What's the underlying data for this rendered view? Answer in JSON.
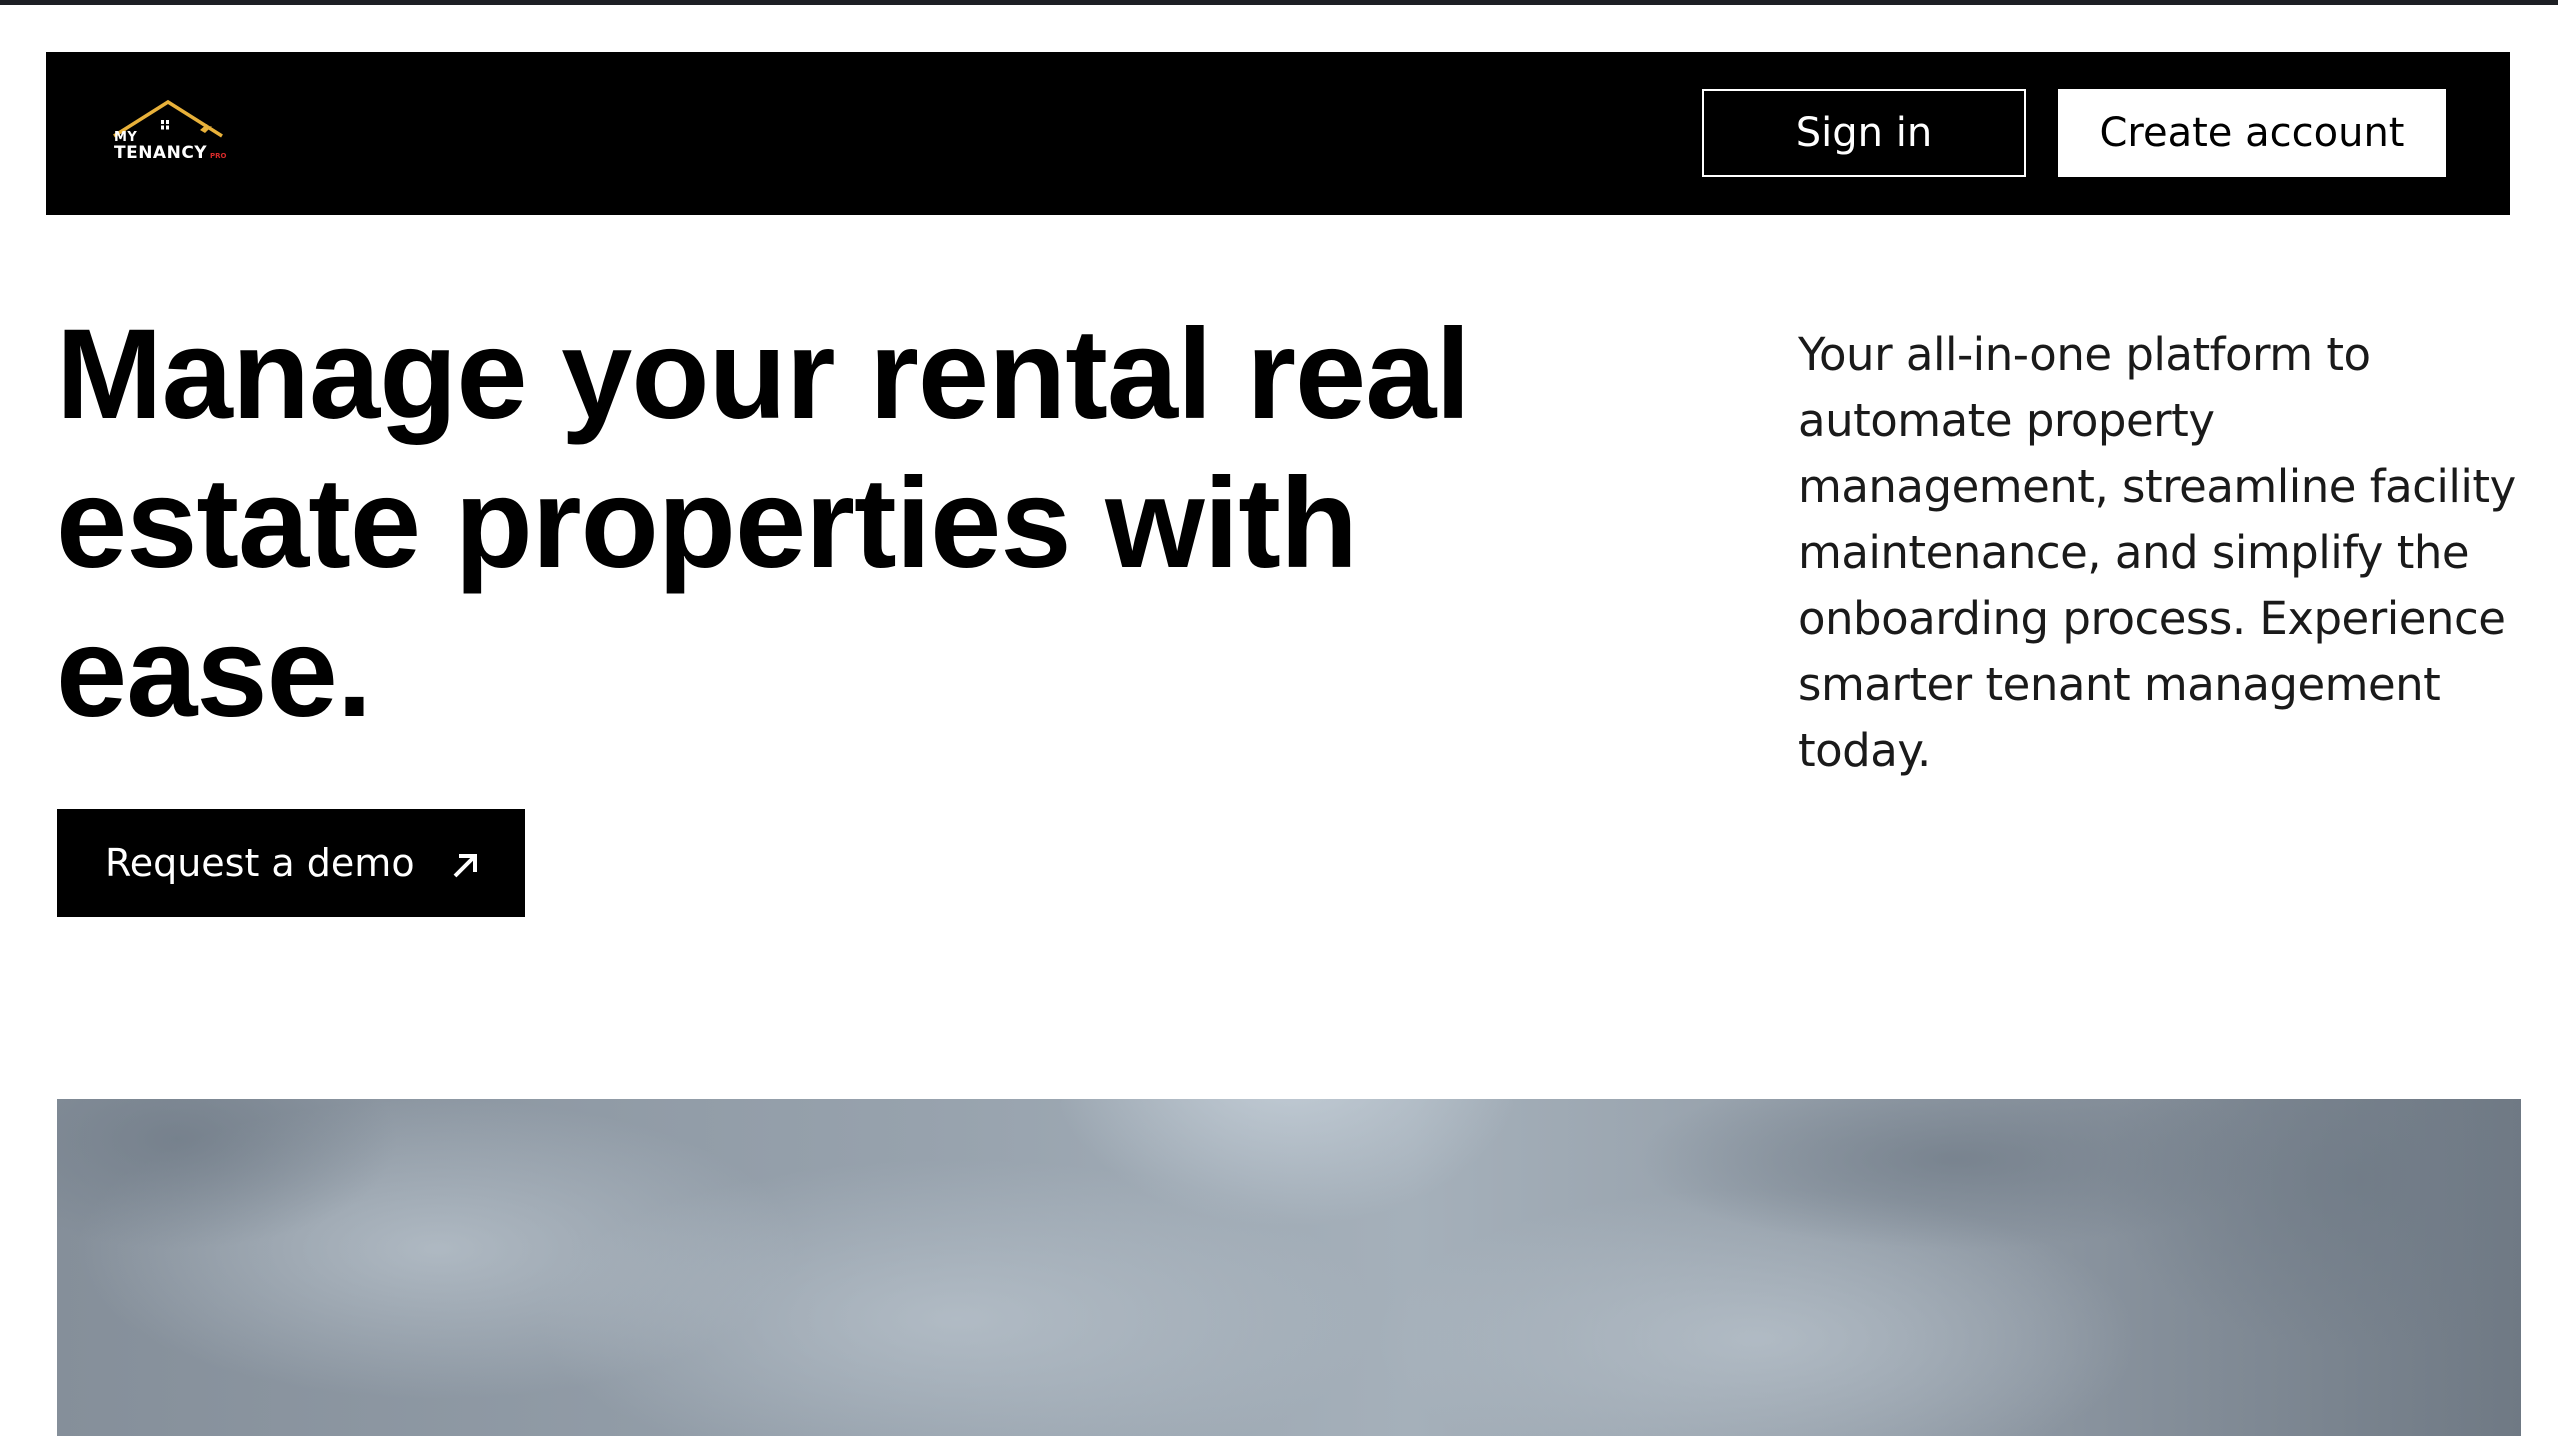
{
  "header": {
    "logo": {
      "line1": "MY",
      "line2": "TENANCY",
      "suffix": "PRO",
      "colors": {
        "roof": "#e8b13a",
        "text": "#ffffff",
        "suffix": "#d62a2a"
      }
    },
    "sign_in_label": "Sign in",
    "create_account_label": "Create account"
  },
  "hero": {
    "title": "Manage your rental real estate properties with ease.",
    "description": "Your all-in-one platform to automate property management, streamline facility maintenance, and simplify the onboarding process. Experience smarter tenant management today.",
    "cta_label": "Request a demo",
    "cta_icon": "arrow-up-right-icon"
  },
  "image": {
    "subject": "cloudy-sky-photo"
  },
  "colors": {
    "header_bg": "#000000",
    "page_bg": "#ffffff",
    "accent": "#000000"
  }
}
